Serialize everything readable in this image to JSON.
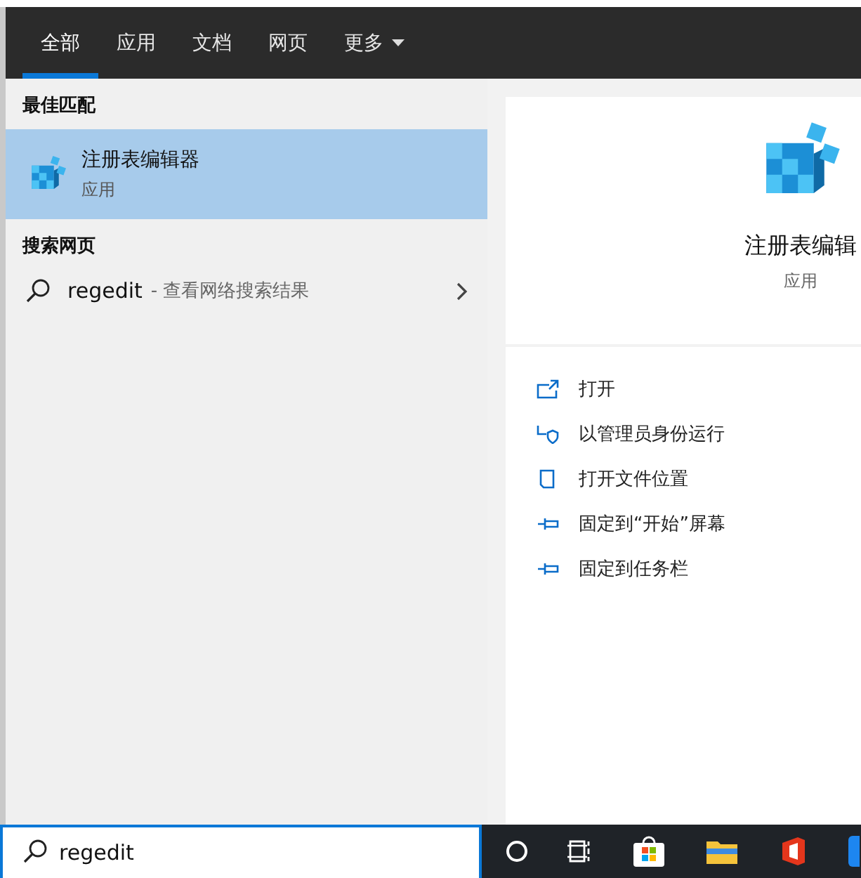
{
  "tabs": [
    {
      "label": "全部",
      "selected": true
    },
    {
      "label": "应用",
      "selected": false
    },
    {
      "label": "文档",
      "selected": false
    },
    {
      "label": "网页",
      "selected": false
    },
    {
      "label": "更多",
      "selected": false,
      "kind": "dropdown"
    }
  ],
  "best_match": {
    "heading": "最佳匹配",
    "name": "注册表编辑器",
    "type": "应用",
    "selected": true
  },
  "web_search": {
    "heading": "搜索网页",
    "query": "regedit",
    "hint": "- 查看网络搜索结果"
  },
  "detail": {
    "name": "注册表编辑",
    "type": "应用"
  },
  "actions": [
    {
      "label": "打开",
      "kind": "open"
    },
    {
      "label": "以管理员身份运行",
      "kind": "admin"
    },
    {
      "label": "打开文件位置",
      "kind": "folder"
    },
    {
      "label": "固定到“开始”屏幕",
      "kind": "pin"
    },
    {
      "label": "固定到任务栏",
      "kind": "pin"
    }
  ],
  "search_box": {
    "value": "regedit"
  }
}
